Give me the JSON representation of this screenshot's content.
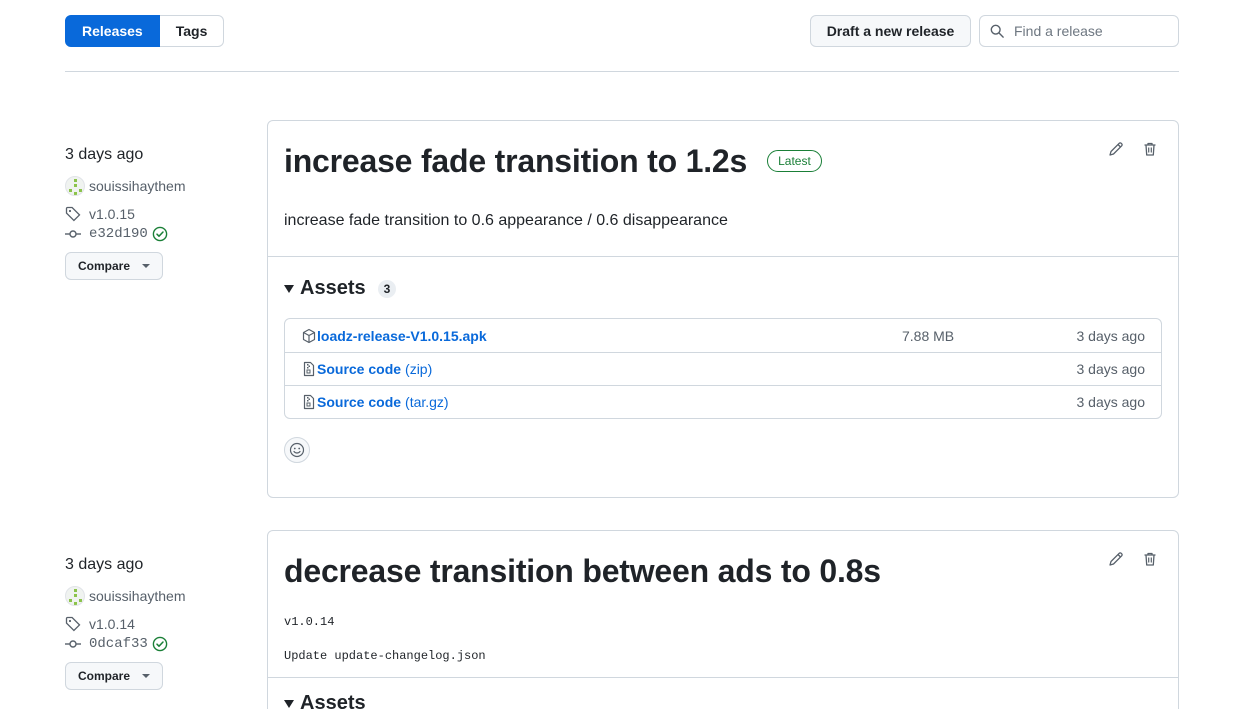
{
  "subnav": {
    "releases": "Releases",
    "tags": "Tags"
  },
  "toolbar": {
    "draft": "Draft a new release",
    "search_placeholder": "Find a release"
  },
  "releases": [
    {
      "date": "3 days ago",
      "author": "souissihaythem",
      "tag": "v1.0.15",
      "commit": "e32d190",
      "compare": "Compare",
      "title": "increase fade transition to 1.2s",
      "badge": "Latest",
      "description": "increase fade transition to 0.6 appearance / 0.6 disappearance",
      "assets_title": "Assets",
      "assets_count": "3",
      "assets": [
        {
          "name": "loadz-release-V1.0.15.apk",
          "ext": "",
          "size": "7.88 MB",
          "date": "3 days ago",
          "icon": "package-icon"
        },
        {
          "name": "Source code",
          "ext": "(zip)",
          "size": "",
          "date": "3 days ago",
          "icon": "file-zip-icon"
        },
        {
          "name": "Source code",
          "ext": "(tar.gz)",
          "size": "",
          "date": "3 days ago",
          "icon": "file-zip-icon"
        }
      ]
    },
    {
      "date": "3 days ago",
      "author": "souissihaythem",
      "tag": "v1.0.14",
      "commit": "0dcaf33",
      "compare": "Compare",
      "title": "decrease transition between ads to 0.8s",
      "line1": "v1.0.14",
      "line2": "Update update-changelog.json",
      "assets_title": "Assets"
    }
  ],
  "colors": {
    "accent": "#0969da",
    "success": "#1a7f37",
    "border": "#d0d7de"
  }
}
